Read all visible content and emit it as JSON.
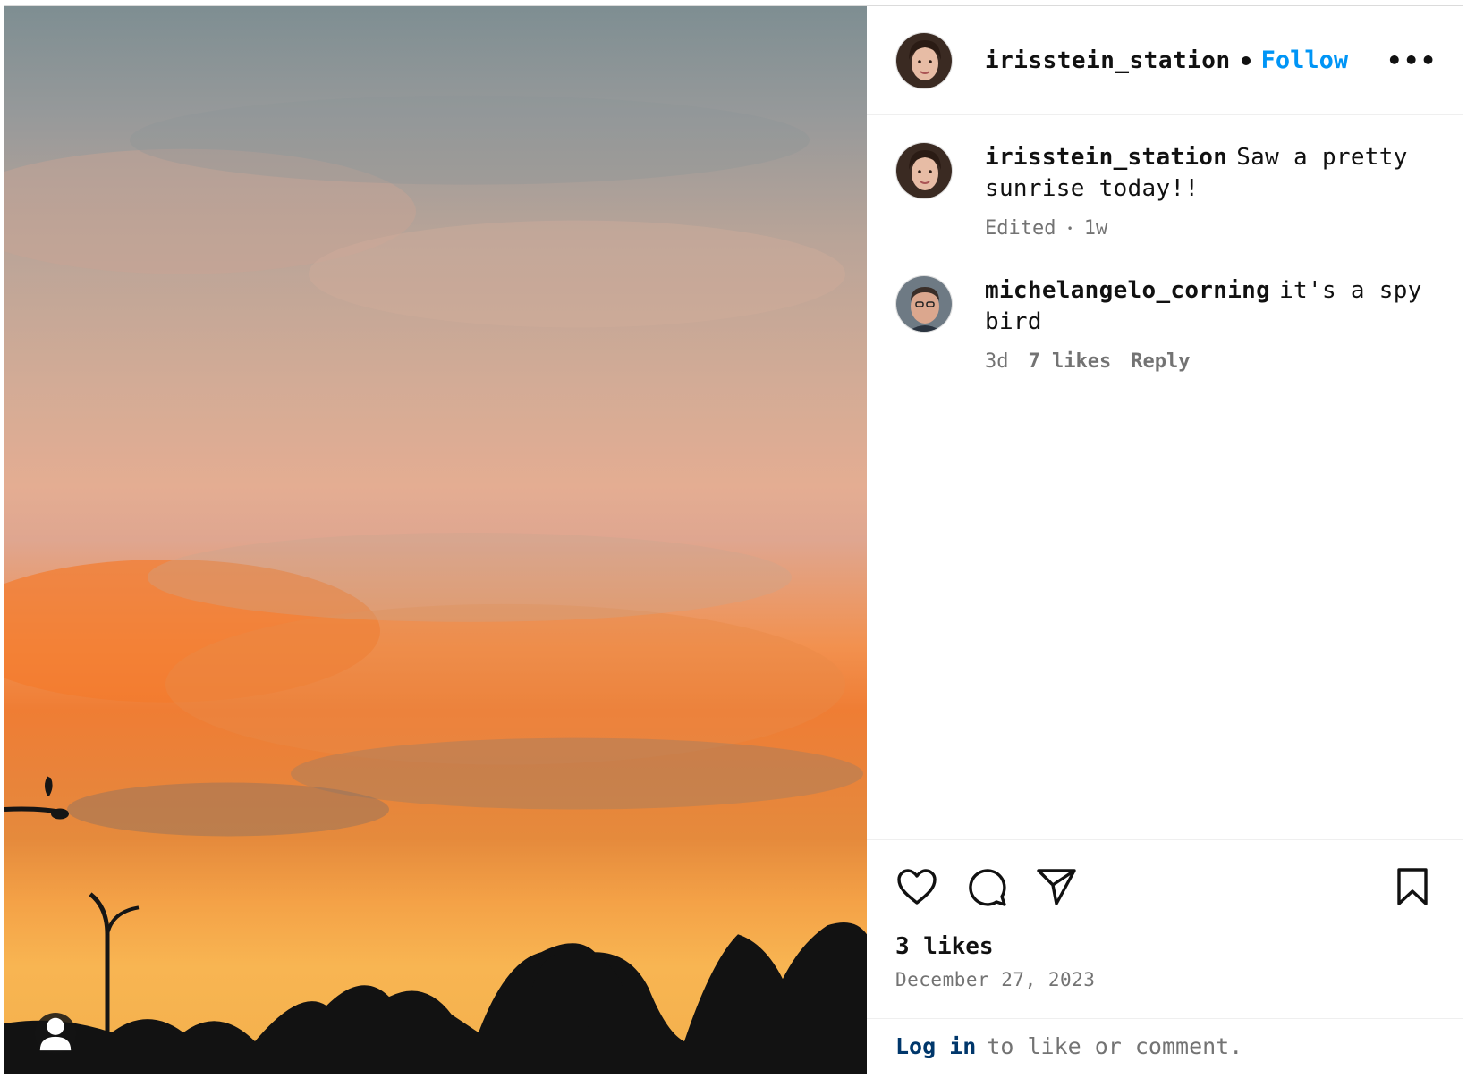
{
  "post": {
    "author": "irisstein_station",
    "follow_label": "Follow",
    "more_label": "•••",
    "image_alt": "Sunrise sky with orange clouds over trees and a street lamp with a bird"
  },
  "comments": [
    {
      "username": "irisstein_station",
      "text": "Saw a pretty sunrise today!!",
      "edited": "Edited",
      "sep": "•",
      "time": "1w"
    },
    {
      "username": "michelangelo_corning",
      "text": "it's a spy bird",
      "time": "3d",
      "likes": "7 likes",
      "reply": "Reply"
    }
  ],
  "footer": {
    "likes": "3 likes",
    "date": "December 27, 2023",
    "login_link": "Log in",
    "login_rest": "to like or comment."
  },
  "colors": {
    "follow": "#0095f6",
    "link": "#00376b",
    "muted": "#737373"
  }
}
